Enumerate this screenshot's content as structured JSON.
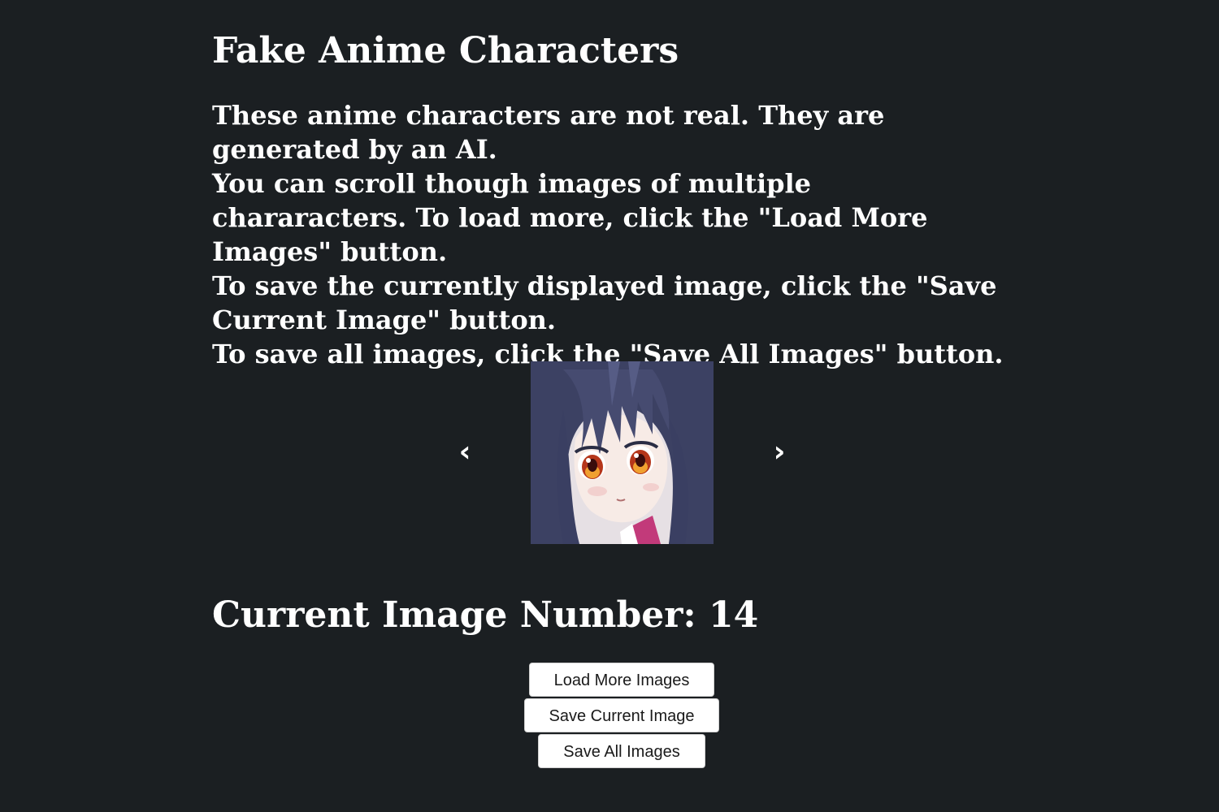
{
  "page": {
    "title": "Fake Anime Characters",
    "intro_lines": [
      "These anime characters are not real. They are generated by an AI.",
      "You can scroll though images of multiple chararacters. To load more, click the \"Load More Images\" button.",
      "To save the currently displayed image, click the \"Save Current Image\" button.",
      "To save all images, click the \"Save All Images\" button."
    ]
  },
  "carousel": {
    "prev_label": "‹",
    "next_label": "›",
    "image_alt": "anime character portrait"
  },
  "status": {
    "current_image_text": "Current Image Number: 14",
    "current_image_number": 14
  },
  "buttons": {
    "load_more": "Load More Images",
    "save_current": "Save Current Image",
    "save_all": "Save All Images"
  },
  "colors": {
    "background": "#1b1f22",
    "text": "#ffffff",
    "button_bg": "#ffffff",
    "button_text": "#1a1a1a"
  }
}
